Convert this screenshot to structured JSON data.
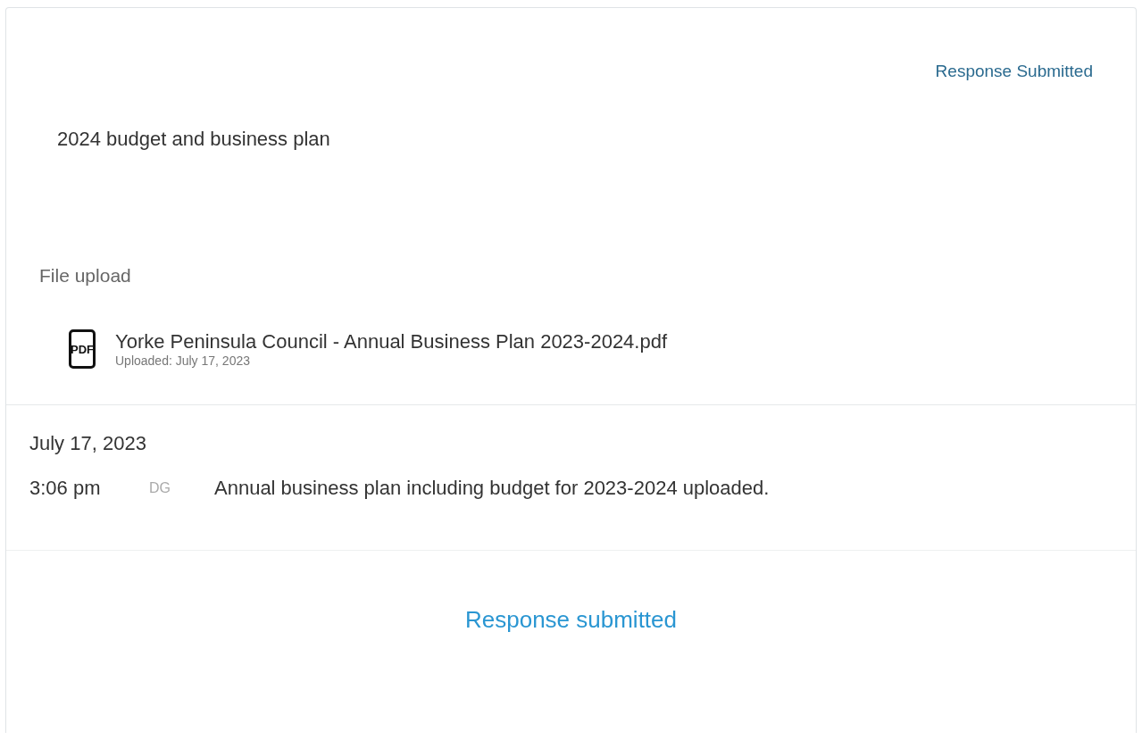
{
  "status": "Response Submitted",
  "title": "2024 budget and business plan",
  "section_label": "File upload",
  "files": [
    {
      "icon_text": "PDF",
      "name": "Yorke Peninsula Council - Annual Business Plan 2023-2024.pdf",
      "uploaded": "Uploaded: July 17, 2023"
    }
  ],
  "activity": [
    {
      "date": "July 17, 2023",
      "entries": [
        {
          "time": "3:06 pm",
          "initials": "DG",
          "text": "Annual business plan including budget for 2023-2024 uploaded."
        }
      ]
    }
  ],
  "footer_status": "Response submitted"
}
